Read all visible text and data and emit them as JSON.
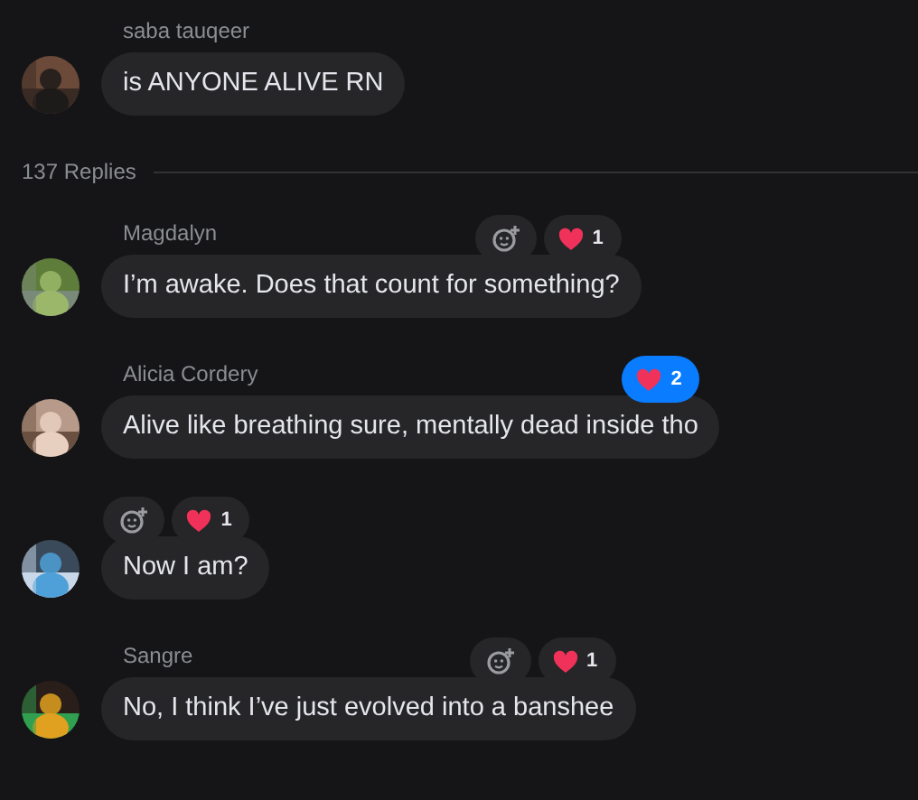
{
  "thread": {
    "parent": {
      "author": "saba tauqeer",
      "text": "is ANYONE ALIVE RN"
    },
    "replies_label": "137 Replies",
    "replies": [
      {
        "author": "Magdalyn",
        "text": "I’m awake. Does that count for something?",
        "add_reaction": true,
        "reaction": {
          "count": "1",
          "selected": false
        }
      },
      {
        "author": "Alicia Cordery",
        "text": "Alive like breathing sure, mentally dead inside tho",
        "add_reaction": false,
        "reaction": {
          "count": "2",
          "selected": true
        }
      },
      {
        "text": "Now I am?",
        "add_reaction": true,
        "reaction": {
          "count": "1",
          "selected": false
        }
      },
      {
        "author": "Sangre",
        "text": "No, I think I’ve just evolved into a banshee",
        "add_reaction": true,
        "reaction": {
          "count": "1",
          "selected": false
        }
      }
    ]
  }
}
